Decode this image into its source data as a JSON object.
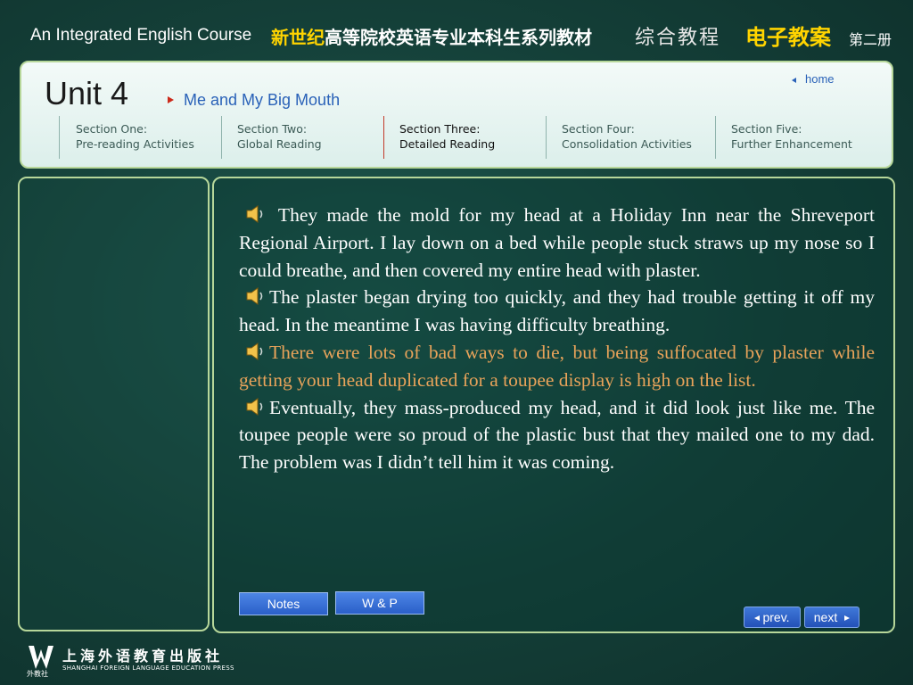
{
  "header": {
    "course_en": "An Integrated English Course",
    "series_highlight": "新世纪",
    "series_rest": "高等院校英语专业本科生系列教材",
    "title_zh": "综合教程",
    "ejiao": "电子教案",
    "volume": "第二册"
  },
  "nav": {
    "unit": "Unit 4",
    "lesson": "Me and My Big Mouth",
    "home": "home",
    "sections": [
      {
        "line1": "Section One:",
        "line2": "Pre-reading Activities"
      },
      {
        "line1": "Section Two:",
        "line2": "Global Reading"
      },
      {
        "line1": "Section Three:",
        "line2": "Detailed Reading"
      },
      {
        "line1": "Section Four:",
        "line2": "Consolidation Activities"
      },
      {
        "line1": "Section Five:",
        "line2": "Further Enhancement"
      }
    ]
  },
  "content": {
    "paragraphs": [
      " They made the mold for my head at a Holiday Inn near the Shreveport Regional Airport. I lay down on a bed while people stuck straws up my nose so I could breathe, and then covered my entire head with plaster.",
      "The plaster began drying too quickly, and they had trouble getting it off my head. In the meantime I was having difficulty breathing.",
      "There were lots of bad ways to die, but being suffocated by plaster while getting your head duplicated for a toupee display is high on the list.",
      "Eventually, they mass-produced my head, and it did look just like me.  The toupee people were so proud of the plastic bust that they mailed one to my dad. The problem was I didn’t tell him it was coming."
    ],
    "highlight_color": "#e8a35a"
  },
  "buttons": {
    "notes": "Notes",
    "wp": "W & P",
    "prev": "prev.",
    "next": "next"
  },
  "footer": {
    "publisher_zh": "上海外语教育出版社",
    "publisher_en": "SHANGHAI FOREIGN LANGUAGE EDUCATION PRESS",
    "publisher_short": "外教社"
  },
  "icons": {
    "speaker": "speaker-icon",
    "home": "triangle-left-icon",
    "prev": "triangle-left-icon",
    "next": "triangle-right-icon",
    "lesson": "triangle-right-icon",
    "logo": "publisher-logo-icon"
  },
  "colors": {
    "accent_yellow": "#ffd400",
    "link_blue": "#2a62b8",
    "panel_border": "#b7d79a",
    "active_marker": "#c23a2a"
  }
}
